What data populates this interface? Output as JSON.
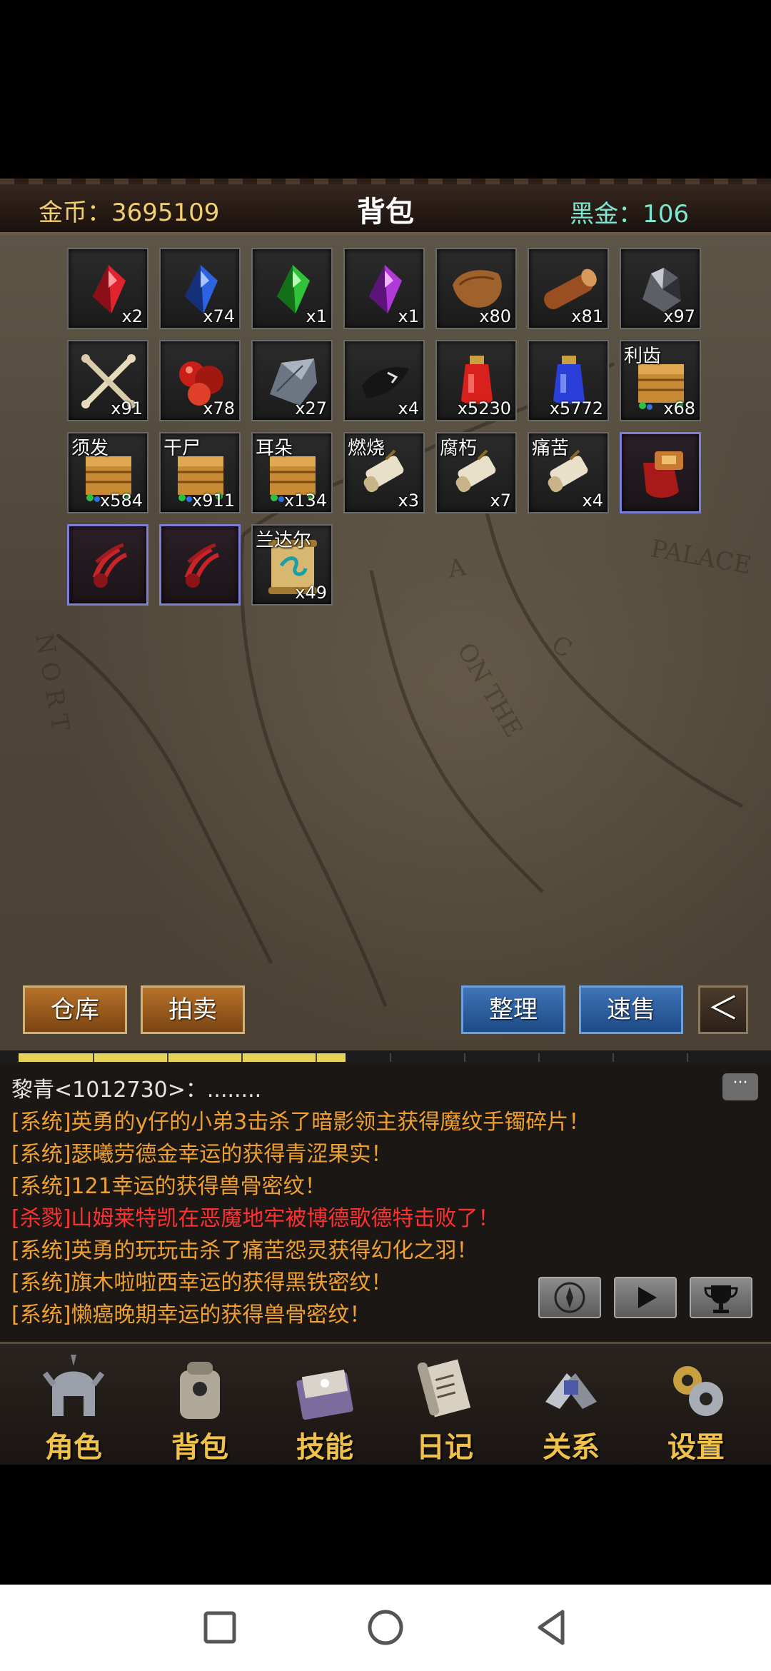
{
  "header": {
    "gold_label": "金币：",
    "gold_value": "3695109",
    "title": "背包",
    "black_gold_label": "黑金：",
    "black_gold_value": "106"
  },
  "inventory": [
    {
      "icon": "red-gem-icon",
      "count": "x2",
      "tag": ""
    },
    {
      "icon": "blue-gem-icon",
      "count": "x74",
      "tag": ""
    },
    {
      "icon": "green-gem-icon",
      "count": "x1",
      "tag": ""
    },
    {
      "icon": "purple-gem-icon",
      "count": "x1",
      "tag": ""
    },
    {
      "icon": "leather-hide-icon",
      "count": "x80",
      "tag": ""
    },
    {
      "icon": "wood-log-icon",
      "count": "x81",
      "tag": ""
    },
    {
      "icon": "iron-ore-icon",
      "count": "x97",
      "tag": ""
    },
    {
      "icon": "bones-icon",
      "count": "x91",
      "tag": ""
    },
    {
      "icon": "red-ore-icon",
      "count": "x78",
      "tag": ""
    },
    {
      "icon": "gray-stone-icon",
      "count": "x27",
      "tag": ""
    },
    {
      "icon": "dark-shard-icon",
      "count": "x4",
      "tag": ""
    },
    {
      "icon": "red-potion-icon",
      "count": "x5230",
      "tag": ""
    },
    {
      "icon": "blue-potion-icon",
      "count": "x5772",
      "tag": ""
    },
    {
      "icon": "chest-icon",
      "count": "x68",
      "tag": "利齿"
    },
    {
      "icon": "chest-icon",
      "count": "x584",
      "tag": "须发"
    },
    {
      "icon": "chest-icon",
      "count": "x911",
      "tag": "干尸"
    },
    {
      "icon": "chest-icon",
      "count": "x134",
      "tag": "耳朵"
    },
    {
      "icon": "scroll-icon",
      "count": "x3",
      "tag": "燃烧"
    },
    {
      "icon": "scroll-icon",
      "count": "x7",
      "tag": "腐朽"
    },
    {
      "icon": "scroll-icon",
      "count": "x4",
      "tag": "痛苦"
    },
    {
      "icon": "red-gauntlet-icon",
      "count": "",
      "tag": ""
    },
    {
      "icon": "skeleton-glove-icon",
      "count": "",
      "tag": ""
    },
    {
      "icon": "skeleton-glove-icon",
      "count": "",
      "tag": ""
    },
    {
      "icon": "rune-scroll-icon",
      "count": "x49",
      "tag": "兰达尔"
    }
  ],
  "buttons": {
    "warehouse": "仓库",
    "auction": "拍卖",
    "sort": "整理",
    "quick_sell": "速售",
    "back": "＜"
  },
  "xp_progress": 0.44,
  "chat": {
    "lines": [
      {
        "type": "name",
        "text": "黎青<1012730>：........"
      },
      {
        "type": "sys",
        "text": "[系统]英勇的y仔的小弟3击杀了暗影领主获得魔纹手镯碎片！"
      },
      {
        "type": "sys",
        "text": "[系统]瑟曦劳德金幸运的获得青涩果实！"
      },
      {
        "type": "sys",
        "text": "[系统]121幸运的获得兽骨密纹！"
      },
      {
        "type": "kill",
        "text": "[杀戮]山姆莱特凯在恶魔地牢被博德歌德特击败了！"
      },
      {
        "type": "sys",
        "text": "[系统]英勇的玩玩击杀了痛苦怨灵获得幻化之羽！"
      },
      {
        "type": "sys",
        "text": "[系统]旗木啦啦西幸运的获得黑铁密纹！"
      },
      {
        "type": "sys",
        "text": "[系统]懒癌晚期幸运的获得兽骨密纹！"
      }
    ],
    "bubble": "···"
  },
  "nav": [
    {
      "label": "角色",
      "icon": "helmet-icon"
    },
    {
      "label": "背包",
      "icon": "backpack-icon"
    },
    {
      "label": "技能",
      "icon": "spellbook-icon"
    },
    {
      "label": "日记",
      "icon": "scroll-journal-icon"
    },
    {
      "label": "关系",
      "icon": "handshake-icon"
    },
    {
      "label": "设置",
      "icon": "gears-icon"
    }
  ],
  "colors": {
    "gold": "#e8c45a",
    "black_gold": "#7ee6d0",
    "system_msg": "#f0a030",
    "kill_msg": "#ff3030",
    "nav_label": "#f0c24a"
  }
}
